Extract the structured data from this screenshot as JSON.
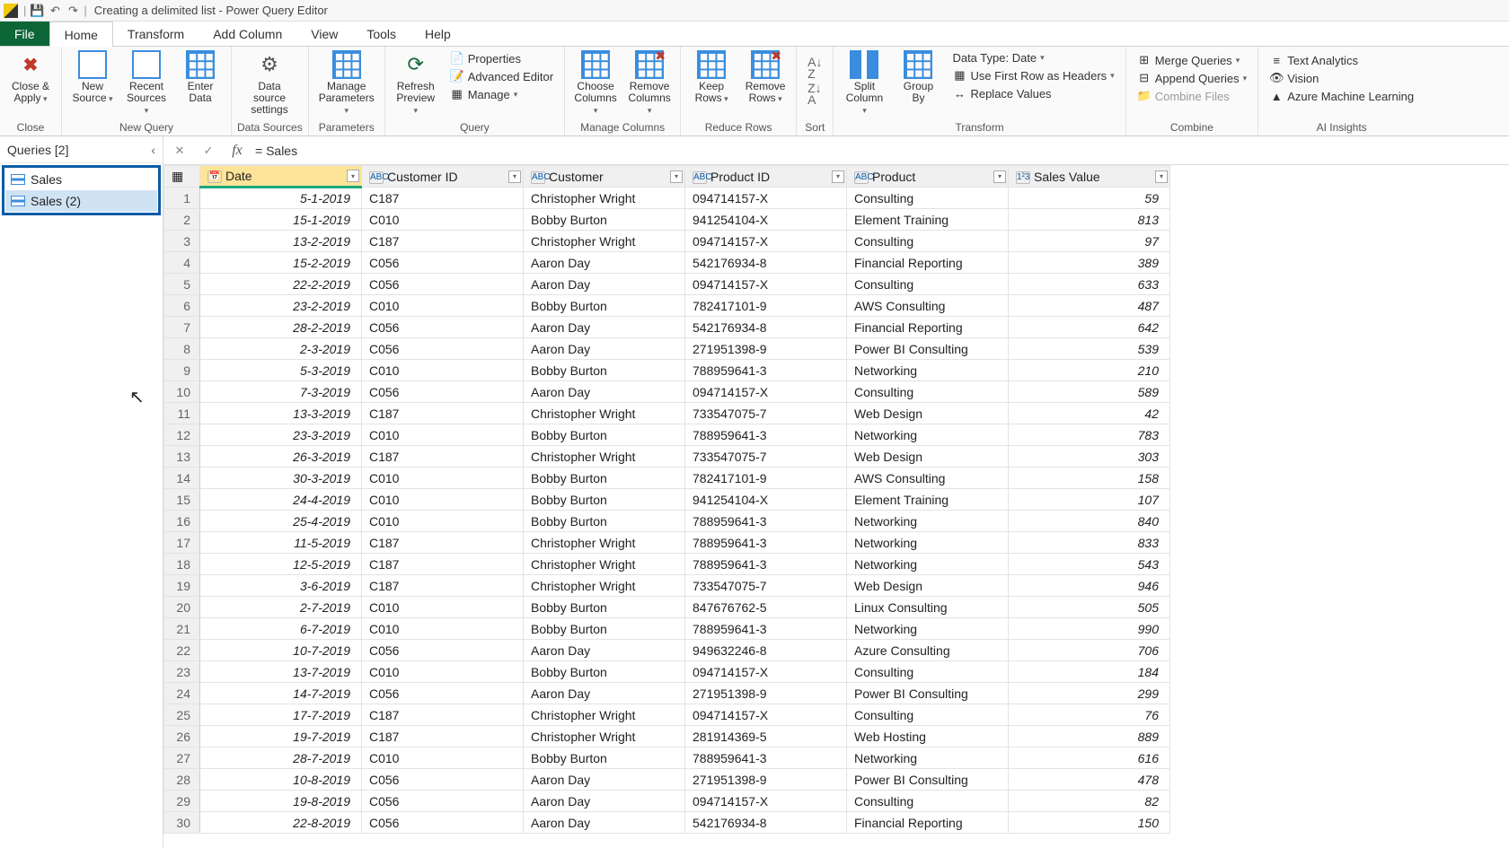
{
  "title": "Creating a delimited list - Power Query Editor",
  "menu": {
    "file": "File",
    "home": "Home",
    "transform": "Transform",
    "addcol": "Add Column",
    "view": "View",
    "tools": "Tools",
    "help": "Help"
  },
  "ribbon": {
    "close": {
      "label": "Close &\nApply",
      "group": "Close"
    },
    "newquery": {
      "new_source": "New\nSource",
      "recent": "Recent\nSources",
      "enter": "Enter\nData",
      "group": "New Query"
    },
    "datasources": {
      "settings": "Data source\nsettings",
      "group": "Data Sources"
    },
    "parameters": {
      "label": "Manage\nParameters",
      "group": "Parameters"
    },
    "query": {
      "refresh": "Refresh\nPreview",
      "properties": "Properties",
      "advanced": "Advanced Editor",
      "manage": "Manage",
      "group": "Query"
    },
    "managecols": {
      "choose": "Choose\nColumns",
      "remove": "Remove\nColumns",
      "group": "Manage Columns"
    },
    "reducerows": {
      "keep": "Keep\nRows",
      "remove": "Remove\nRows",
      "group": "Reduce Rows"
    },
    "sort": {
      "group": "Sort"
    },
    "transform": {
      "split": "Split\nColumn",
      "group_by": "Group\nBy",
      "datatype": "Data Type: Date",
      "firstrow": "Use First Row as Headers",
      "replace": "Replace Values",
      "group": "Transform"
    },
    "combine": {
      "merge": "Merge Queries",
      "append": "Append Queries",
      "files": "Combine Files",
      "group": "Combine"
    },
    "ai": {
      "text": "Text Analytics",
      "vision": "Vision",
      "aml": "Azure Machine Learning",
      "group": "AI Insights"
    }
  },
  "queries": {
    "header": "Queries [2]",
    "items": [
      "Sales",
      "Sales (2)"
    ]
  },
  "formula": "= Sales",
  "columns": [
    {
      "name": "Date",
      "type": "date",
      "selected": true
    },
    {
      "name": "Customer ID",
      "type": "text"
    },
    {
      "name": "Customer",
      "type": "text"
    },
    {
      "name": "Product ID",
      "type": "text"
    },
    {
      "name": "Product",
      "type": "text"
    },
    {
      "name": "Sales Value",
      "type": "number"
    }
  ],
  "rows": [
    [
      "5-1-2019",
      "C187",
      "Christopher Wright",
      "094714157-X",
      "Consulting",
      "59"
    ],
    [
      "15-1-2019",
      "C010",
      "Bobby Burton",
      "941254104-X",
      "Element Training",
      "813"
    ],
    [
      "13-2-2019",
      "C187",
      "Christopher Wright",
      "094714157-X",
      "Consulting",
      "97"
    ],
    [
      "15-2-2019",
      "C056",
      "Aaron Day",
      "542176934-8",
      "Financial Reporting",
      "389"
    ],
    [
      "22-2-2019",
      "C056",
      "Aaron Day",
      "094714157-X",
      "Consulting",
      "633"
    ],
    [
      "23-2-2019",
      "C010",
      "Bobby Burton",
      "782417101-9",
      "AWS Consulting",
      "487"
    ],
    [
      "28-2-2019",
      "C056",
      "Aaron Day",
      "542176934-8",
      "Financial Reporting",
      "642"
    ],
    [
      "2-3-2019",
      "C056",
      "Aaron Day",
      "271951398-9",
      "Power BI Consulting",
      "539"
    ],
    [
      "5-3-2019",
      "C010",
      "Bobby Burton",
      "788959641-3",
      "Networking",
      "210"
    ],
    [
      "7-3-2019",
      "C056",
      "Aaron Day",
      "094714157-X",
      "Consulting",
      "589"
    ],
    [
      "13-3-2019",
      "C187",
      "Christopher Wright",
      "733547075-7",
      "Web Design",
      "42"
    ],
    [
      "23-3-2019",
      "C010",
      "Bobby Burton",
      "788959641-3",
      "Networking",
      "783"
    ],
    [
      "26-3-2019",
      "C187",
      "Christopher Wright",
      "733547075-7",
      "Web Design",
      "303"
    ],
    [
      "30-3-2019",
      "C010",
      "Bobby Burton",
      "782417101-9",
      "AWS Consulting",
      "158"
    ],
    [
      "24-4-2019",
      "C010",
      "Bobby Burton",
      "941254104-X",
      "Element Training",
      "107"
    ],
    [
      "25-4-2019",
      "C010",
      "Bobby Burton",
      "788959641-3",
      "Networking",
      "840"
    ],
    [
      "11-5-2019",
      "C187",
      "Christopher Wright",
      "788959641-3",
      "Networking",
      "833"
    ],
    [
      "12-5-2019",
      "C187",
      "Christopher Wright",
      "788959641-3",
      "Networking",
      "543"
    ],
    [
      "3-6-2019",
      "C187",
      "Christopher Wright",
      "733547075-7",
      "Web Design",
      "946"
    ],
    [
      "2-7-2019",
      "C010",
      "Bobby Burton",
      "847676762-5",
      "Linux Consulting",
      "505"
    ],
    [
      "6-7-2019",
      "C010",
      "Bobby Burton",
      "788959641-3",
      "Networking",
      "990"
    ],
    [
      "10-7-2019",
      "C056",
      "Aaron Day",
      "949632246-8",
      "Azure Consulting",
      "706"
    ],
    [
      "13-7-2019",
      "C010",
      "Bobby Burton",
      "094714157-X",
      "Consulting",
      "184"
    ],
    [
      "14-7-2019",
      "C056",
      "Aaron Day",
      "271951398-9",
      "Power BI Consulting",
      "299"
    ],
    [
      "17-7-2019",
      "C187",
      "Christopher Wright",
      "094714157-X",
      "Consulting",
      "76"
    ],
    [
      "19-7-2019",
      "C187",
      "Christopher Wright",
      "281914369-5",
      "Web Hosting",
      "889"
    ],
    [
      "28-7-2019",
      "C010",
      "Bobby Burton",
      "788959641-3",
      "Networking",
      "616"
    ],
    [
      "10-8-2019",
      "C056",
      "Aaron Day",
      "271951398-9",
      "Power BI Consulting",
      "478"
    ],
    [
      "19-8-2019",
      "C056",
      "Aaron Day",
      "094714157-X",
      "Consulting",
      "82"
    ],
    [
      "22-8-2019",
      "C056",
      "Aaron Day",
      "542176934-8",
      "Financial Reporting",
      "150"
    ]
  ]
}
